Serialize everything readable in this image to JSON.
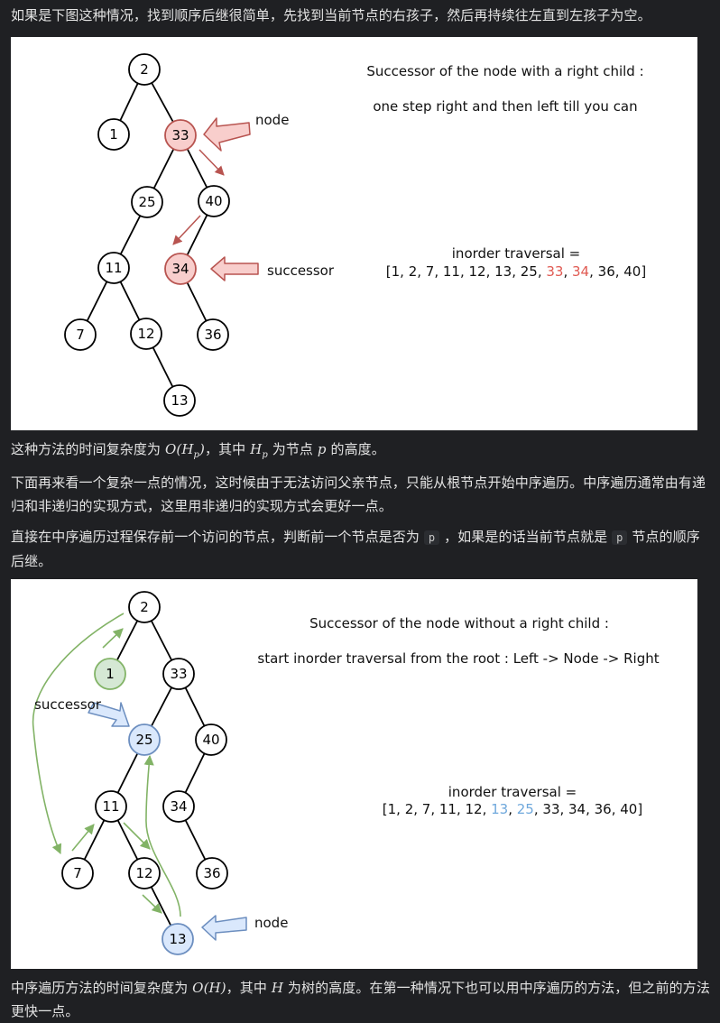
{
  "para1": "如果是下图这种情况，找到顺序后继很简单，先找到当前节点的右孩子，然后再持续往左直到左孩子为空。",
  "para2": {
    "prefix": "这种方法的时间复杂度为 ",
    "big_o": "O(H",
    "sub_p": "p",
    "close": ")",
    "mid": "，其中 ",
    "h": "H",
    "sub_p2": "p",
    "mid2": " 为节点 ",
    "p": "p",
    "suffix": " 的高度。"
  },
  "para3": "下面再来看一个复杂一点的情况，这时候由于无法访问父亲节点，只能从根节点开始中序遍历。中序遍历通常由有递归和非递归的实现方式，这里用非递归的实现方式会更好一点。",
  "para4": {
    "part1": "直接在中序遍历过程保存前一个访问的节点，判断前一个节点是否为 ",
    "code1": "p",
    "part2": " ，如果是的话当前节点就是 ",
    "code2": "p",
    "part3": " 节点的顺序后继。"
  },
  "para5": {
    "prefix": "中序遍历方法的时间复杂度为 ",
    "big_o": "O(H)",
    "mid": "，其中 ",
    "h": "H",
    "suffix": " 为树的高度。在第一种情况下也可以用中序遍历的方法，但之前的方法更快一点。"
  },
  "diagram1": {
    "title": "Successor of the node with a right child :",
    "subtitle": "one step right and then left till you can",
    "node_label": "node",
    "successor_label": "successor",
    "traversal_label": "inorder traversal =",
    "traversal_pre": "[1, 2, 7, 11, 12, 13, 25, ",
    "traversal_hl1": "33",
    "traversal_sep": ", ",
    "traversal_hl2": "34",
    "traversal_post": ", 36, 40]",
    "nodes": {
      "n2": "2",
      "n1": "1",
      "n33": "33",
      "n25": "25",
      "n40": "40",
      "n11": "11",
      "n34": "34",
      "n7": "7",
      "n12": "12",
      "n36": "36",
      "n13": "13"
    },
    "colors": {
      "highlight_fill": "#f8cecc",
      "highlight_stroke": "#b85450",
      "text_red": "#e05a52"
    }
  },
  "diagram2": {
    "title": "Successor of the node without a right child :",
    "subtitle": "start inorder traversal from the root : Left -> Node -> Right",
    "node_label": "node",
    "successor_label": "successor",
    "traversal_label": "inorder traversal =",
    "traversal_pre": "[1, 2, 7, 11, 12, ",
    "traversal_hl1": "13",
    "traversal_sep": ", ",
    "traversal_hl2": "25",
    "traversal_post": ", 33, 34, 36, 40]",
    "nodes": {
      "n2": "2",
      "n1": "1",
      "n33": "33",
      "n25": "25",
      "n40": "40",
      "n11": "11",
      "n34": "34",
      "n7": "7",
      "n12": "12",
      "n36": "36",
      "n13": "13"
    },
    "colors": {
      "green_fill": "#d5e8d4",
      "green_stroke": "#82b366",
      "blue_fill": "#dae8fc",
      "blue_stroke": "#6c8ebf",
      "text_blue": "#6fa8dc"
    }
  }
}
